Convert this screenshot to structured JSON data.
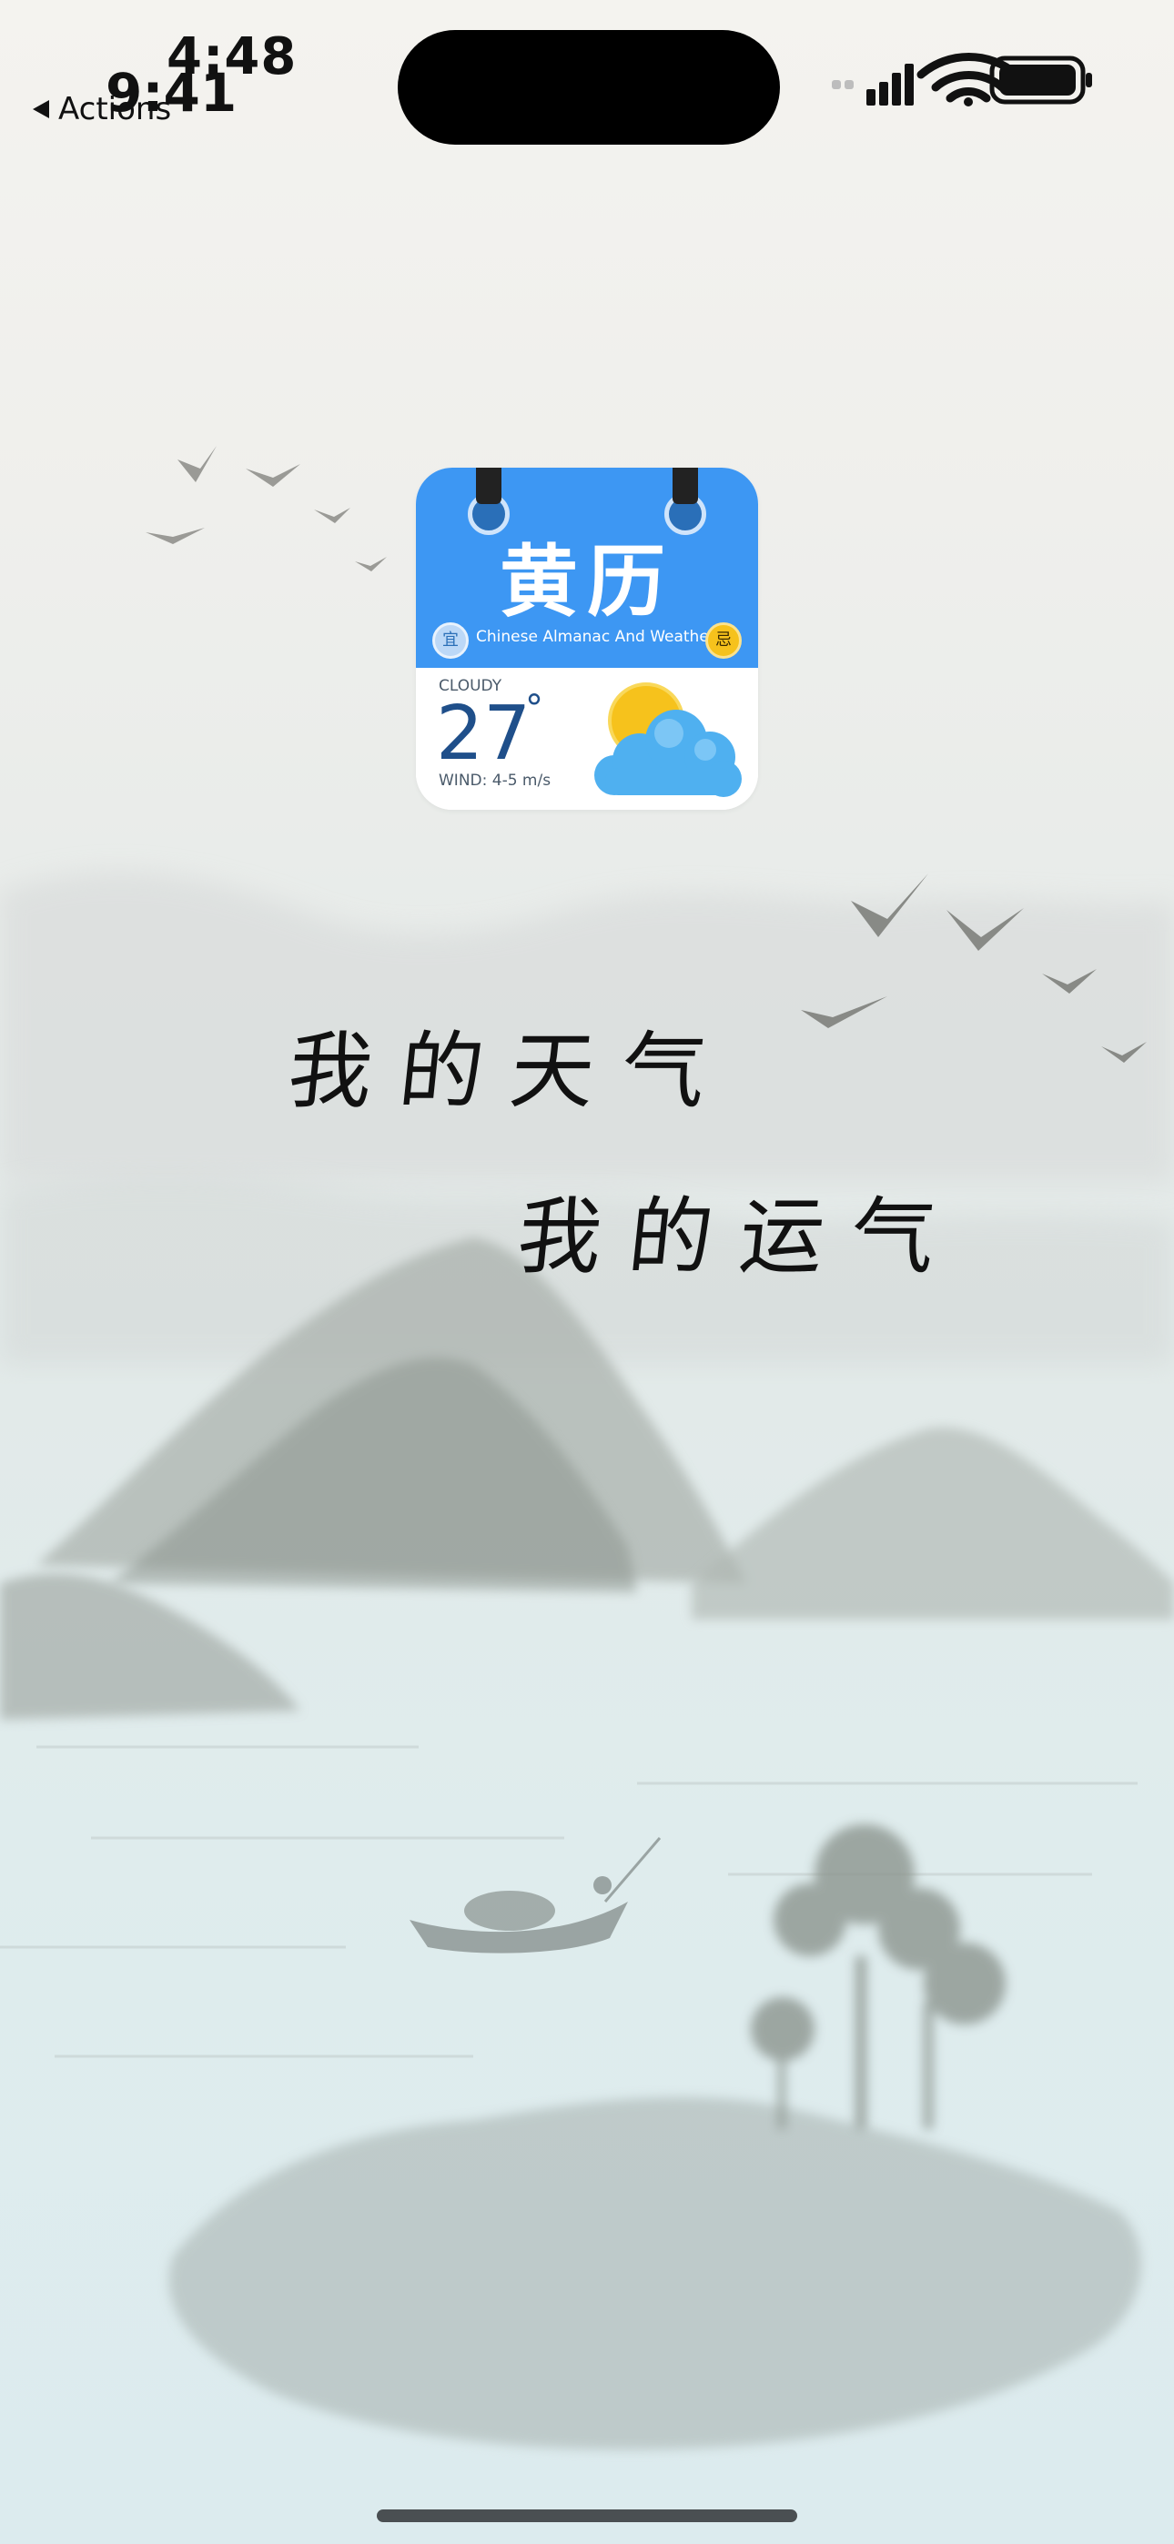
{
  "status_bar": {
    "time_overlay": "4:48",
    "time": "9:41",
    "back_label": "Actions",
    "signal_icon": "cellular-signal-icon",
    "wifi_icon": "wifi-icon",
    "battery_icon": "battery-icon"
  },
  "app_icon": {
    "title": "黄历",
    "subtitle": "Chinese Almanac And Weather",
    "badge_left": "宜",
    "badge_right": "忌",
    "condition": "CLOUDY",
    "temperature": "27",
    "degree_symbol": "°",
    "wind": "WIND: 4-5 m/s",
    "colors": {
      "header": "#3d97f3",
      "temp": "#1f4f8a",
      "sun": "#f6c21c",
      "cloud": "#4fb0f0"
    }
  },
  "slogans": {
    "line1": "我的天气",
    "line2": "我的运气"
  }
}
